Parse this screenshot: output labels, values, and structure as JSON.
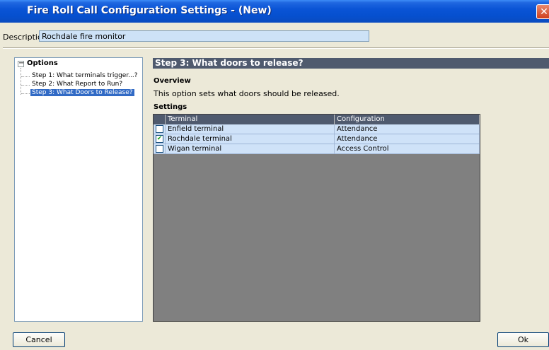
{
  "window": {
    "title": "Fire Roll Call Configuration Settings - (New)",
    "close_glyph": "✕"
  },
  "description": {
    "label": "Description:",
    "value": "Rochdale fire monitor"
  },
  "tree": {
    "toggle_glyph": "−",
    "root": "Options",
    "items": [
      {
        "label": "Step 1: What terminals trigger...?",
        "selected": false
      },
      {
        "label": "Step 2: What Report to Run?",
        "selected": false
      },
      {
        "label": "Step 3: What Doors to Release?",
        "selected": true
      }
    ]
  },
  "panel": {
    "header": "Step 3: What doors to release?",
    "overview_label": "Overview",
    "overview_text": "This option sets what doors should be released.",
    "settings_label": "Settings"
  },
  "grid": {
    "columns": [
      "Terminal",
      "Configuration"
    ],
    "rows": [
      {
        "checked": false,
        "terminal": "Enfield terminal",
        "configuration": "Attendance"
      },
      {
        "checked": true,
        "terminal": "Rochdale terminal",
        "configuration": "Attendance"
      },
      {
        "checked": false,
        "terminal": "Wigan terminal",
        "configuration": "Access Control"
      }
    ],
    "check_glyph": "✔"
  },
  "buttons": {
    "cancel_label": "Cancel",
    "ok_label": "Ok"
  }
}
